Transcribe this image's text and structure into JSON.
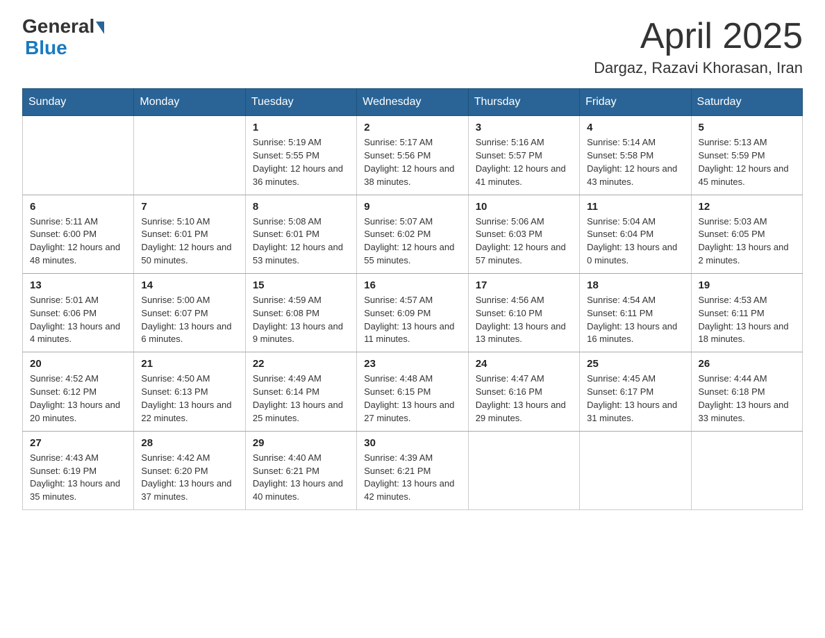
{
  "header": {
    "logo_general": "General",
    "logo_blue": "Blue",
    "month_title": "April 2025",
    "location": "Dargaz, Razavi Khorasan, Iran"
  },
  "calendar": {
    "columns": [
      "Sunday",
      "Monday",
      "Tuesday",
      "Wednesday",
      "Thursday",
      "Friday",
      "Saturday"
    ],
    "weeks": [
      [
        {
          "day": "",
          "sunrise": "",
          "sunset": "",
          "daylight": ""
        },
        {
          "day": "",
          "sunrise": "",
          "sunset": "",
          "daylight": ""
        },
        {
          "day": "1",
          "sunrise": "Sunrise: 5:19 AM",
          "sunset": "Sunset: 5:55 PM",
          "daylight": "Daylight: 12 hours and 36 minutes."
        },
        {
          "day": "2",
          "sunrise": "Sunrise: 5:17 AM",
          "sunset": "Sunset: 5:56 PM",
          "daylight": "Daylight: 12 hours and 38 minutes."
        },
        {
          "day": "3",
          "sunrise": "Sunrise: 5:16 AM",
          "sunset": "Sunset: 5:57 PM",
          "daylight": "Daylight: 12 hours and 41 minutes."
        },
        {
          "day": "4",
          "sunrise": "Sunrise: 5:14 AM",
          "sunset": "Sunset: 5:58 PM",
          "daylight": "Daylight: 12 hours and 43 minutes."
        },
        {
          "day": "5",
          "sunrise": "Sunrise: 5:13 AM",
          "sunset": "Sunset: 5:59 PM",
          "daylight": "Daylight: 12 hours and 45 minutes."
        }
      ],
      [
        {
          "day": "6",
          "sunrise": "Sunrise: 5:11 AM",
          "sunset": "Sunset: 6:00 PM",
          "daylight": "Daylight: 12 hours and 48 minutes."
        },
        {
          "day": "7",
          "sunrise": "Sunrise: 5:10 AM",
          "sunset": "Sunset: 6:01 PM",
          "daylight": "Daylight: 12 hours and 50 minutes."
        },
        {
          "day": "8",
          "sunrise": "Sunrise: 5:08 AM",
          "sunset": "Sunset: 6:01 PM",
          "daylight": "Daylight: 12 hours and 53 minutes."
        },
        {
          "day": "9",
          "sunrise": "Sunrise: 5:07 AM",
          "sunset": "Sunset: 6:02 PM",
          "daylight": "Daylight: 12 hours and 55 minutes."
        },
        {
          "day": "10",
          "sunrise": "Sunrise: 5:06 AM",
          "sunset": "Sunset: 6:03 PM",
          "daylight": "Daylight: 12 hours and 57 minutes."
        },
        {
          "day": "11",
          "sunrise": "Sunrise: 5:04 AM",
          "sunset": "Sunset: 6:04 PM",
          "daylight": "Daylight: 13 hours and 0 minutes."
        },
        {
          "day": "12",
          "sunrise": "Sunrise: 5:03 AM",
          "sunset": "Sunset: 6:05 PM",
          "daylight": "Daylight: 13 hours and 2 minutes."
        }
      ],
      [
        {
          "day": "13",
          "sunrise": "Sunrise: 5:01 AM",
          "sunset": "Sunset: 6:06 PM",
          "daylight": "Daylight: 13 hours and 4 minutes."
        },
        {
          "day": "14",
          "sunrise": "Sunrise: 5:00 AM",
          "sunset": "Sunset: 6:07 PM",
          "daylight": "Daylight: 13 hours and 6 minutes."
        },
        {
          "day": "15",
          "sunrise": "Sunrise: 4:59 AM",
          "sunset": "Sunset: 6:08 PM",
          "daylight": "Daylight: 13 hours and 9 minutes."
        },
        {
          "day": "16",
          "sunrise": "Sunrise: 4:57 AM",
          "sunset": "Sunset: 6:09 PM",
          "daylight": "Daylight: 13 hours and 11 minutes."
        },
        {
          "day": "17",
          "sunrise": "Sunrise: 4:56 AM",
          "sunset": "Sunset: 6:10 PM",
          "daylight": "Daylight: 13 hours and 13 minutes."
        },
        {
          "day": "18",
          "sunrise": "Sunrise: 4:54 AM",
          "sunset": "Sunset: 6:11 PM",
          "daylight": "Daylight: 13 hours and 16 minutes."
        },
        {
          "day": "19",
          "sunrise": "Sunrise: 4:53 AM",
          "sunset": "Sunset: 6:11 PM",
          "daylight": "Daylight: 13 hours and 18 minutes."
        }
      ],
      [
        {
          "day": "20",
          "sunrise": "Sunrise: 4:52 AM",
          "sunset": "Sunset: 6:12 PM",
          "daylight": "Daylight: 13 hours and 20 minutes."
        },
        {
          "day": "21",
          "sunrise": "Sunrise: 4:50 AM",
          "sunset": "Sunset: 6:13 PM",
          "daylight": "Daylight: 13 hours and 22 minutes."
        },
        {
          "day": "22",
          "sunrise": "Sunrise: 4:49 AM",
          "sunset": "Sunset: 6:14 PM",
          "daylight": "Daylight: 13 hours and 25 minutes."
        },
        {
          "day": "23",
          "sunrise": "Sunrise: 4:48 AM",
          "sunset": "Sunset: 6:15 PM",
          "daylight": "Daylight: 13 hours and 27 minutes."
        },
        {
          "day": "24",
          "sunrise": "Sunrise: 4:47 AM",
          "sunset": "Sunset: 6:16 PM",
          "daylight": "Daylight: 13 hours and 29 minutes."
        },
        {
          "day": "25",
          "sunrise": "Sunrise: 4:45 AM",
          "sunset": "Sunset: 6:17 PM",
          "daylight": "Daylight: 13 hours and 31 minutes."
        },
        {
          "day": "26",
          "sunrise": "Sunrise: 4:44 AM",
          "sunset": "Sunset: 6:18 PM",
          "daylight": "Daylight: 13 hours and 33 minutes."
        }
      ],
      [
        {
          "day": "27",
          "sunrise": "Sunrise: 4:43 AM",
          "sunset": "Sunset: 6:19 PM",
          "daylight": "Daylight: 13 hours and 35 minutes."
        },
        {
          "day": "28",
          "sunrise": "Sunrise: 4:42 AM",
          "sunset": "Sunset: 6:20 PM",
          "daylight": "Daylight: 13 hours and 37 minutes."
        },
        {
          "day": "29",
          "sunrise": "Sunrise: 4:40 AM",
          "sunset": "Sunset: 6:21 PM",
          "daylight": "Daylight: 13 hours and 40 minutes."
        },
        {
          "day": "30",
          "sunrise": "Sunrise: 4:39 AM",
          "sunset": "Sunset: 6:21 PM",
          "daylight": "Daylight: 13 hours and 42 minutes."
        },
        {
          "day": "",
          "sunrise": "",
          "sunset": "",
          "daylight": ""
        },
        {
          "day": "",
          "sunrise": "",
          "sunset": "",
          "daylight": ""
        },
        {
          "day": "",
          "sunrise": "",
          "sunset": "",
          "daylight": ""
        }
      ]
    ]
  }
}
